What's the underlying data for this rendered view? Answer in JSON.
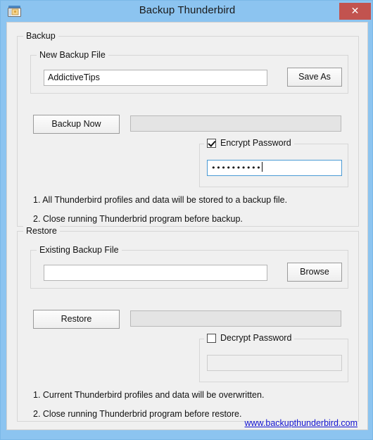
{
  "window": {
    "title": "Backup Thunderbird",
    "icon": "backup-window-icon",
    "close_label": "✕",
    "frame_color": "#8cc4f0",
    "close_color": "#c2534f",
    "client_color": "#f0f0f0"
  },
  "backup": {
    "group_label": "Backup",
    "file_group_label": "New Backup File",
    "file_value": "AddictiveTips",
    "file_placeholder": "",
    "save_as_label": "Save As",
    "backup_now_label": "Backup Now",
    "progress_value": 0,
    "encrypt": {
      "group_label": "Encrypt Password",
      "checked": true,
      "password_masked": "••••••••••",
      "enabled": true
    },
    "notes": [
      "1. All Thunderbird profiles and data will be stored to a backup file.",
      "2. Close running Thunderbrid program before backup."
    ]
  },
  "restore": {
    "group_label": "Restore",
    "file_group_label": "Existing Backup File",
    "file_value": "",
    "file_placeholder": "",
    "browse_label": "Browse",
    "restore_label": "Restore",
    "progress_value": 0,
    "decrypt": {
      "group_label": "Decrypt Password",
      "checked": false,
      "password_masked": "",
      "enabled": false
    },
    "notes": [
      "1. Current Thunderbird profiles and data will be overwritten.",
      "2. Close running Thunderbrid program before restore."
    ]
  },
  "footer": {
    "website_label": "www.backupthunderbird.com",
    "link_color": "#1414d2"
  }
}
